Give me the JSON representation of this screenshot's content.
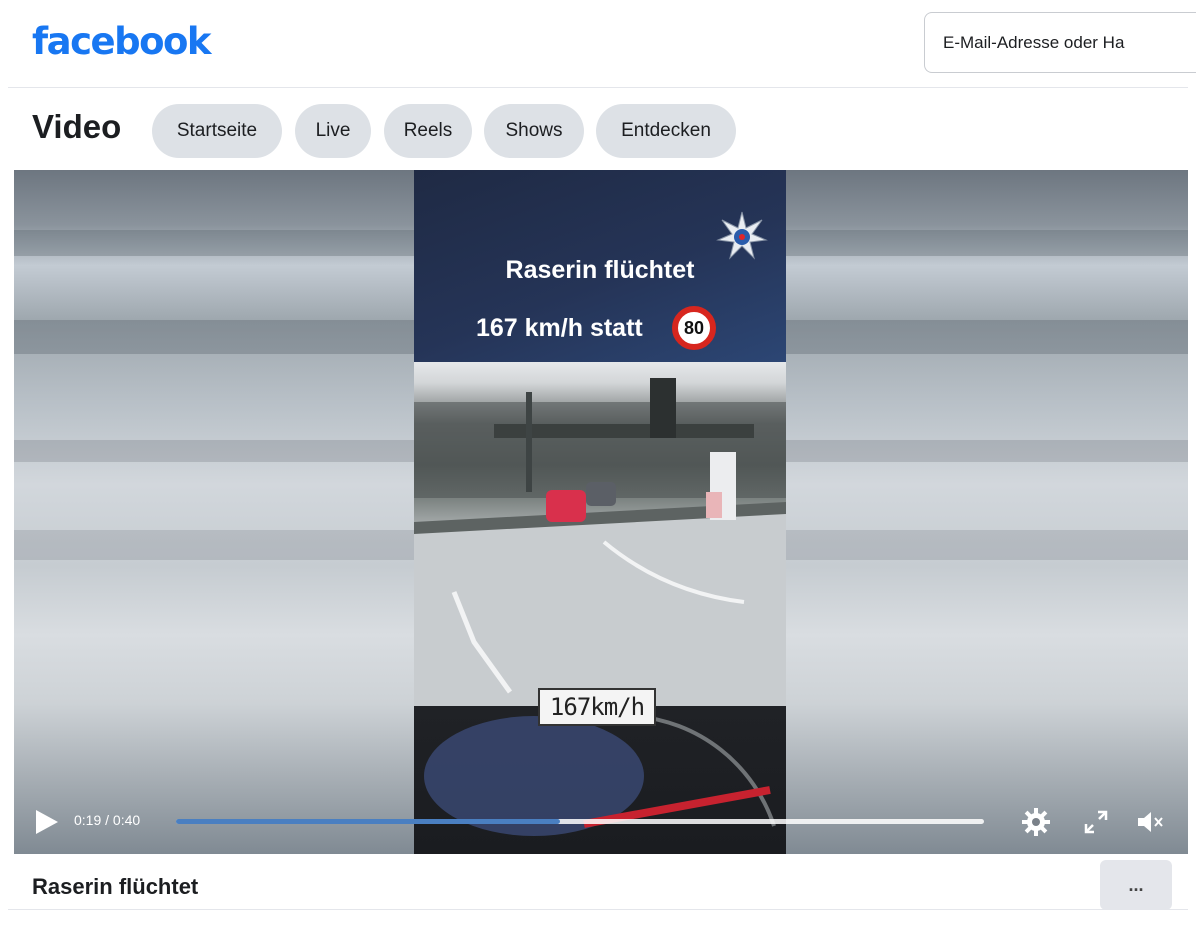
{
  "header": {
    "logo": "facebook",
    "email_placeholder": "E-Mail-Adresse oder Ha"
  },
  "video_nav": {
    "title": "Video",
    "tabs": [
      {
        "label": "Startseite"
      },
      {
        "label": "Live"
      },
      {
        "label": "Reels"
      },
      {
        "label": "Shows"
      },
      {
        "label": "Entdecken"
      }
    ]
  },
  "video": {
    "overlay_title": "Raserin flüchtet",
    "overlay_speed_text": "167 km/h statt",
    "speed_limit_sign": "80",
    "speed_readout": "167km/h",
    "time_display": "0:19 / 0:40",
    "progress_fraction": 0.475,
    "accent_color": "#4a7fc1",
    "controls": {
      "play_icon": "play-icon",
      "settings_icon": "gear-icon",
      "fullscreen_icon": "expand-icon",
      "mute_icon": "volume-muted-icon"
    }
  },
  "post": {
    "title": "Raserin flüchtet",
    "more_label": "..."
  },
  "colors": {
    "brand": "#1877f2",
    "pill_bg": "#dde1e6",
    "speed_sign_ring": "#d7261e"
  }
}
